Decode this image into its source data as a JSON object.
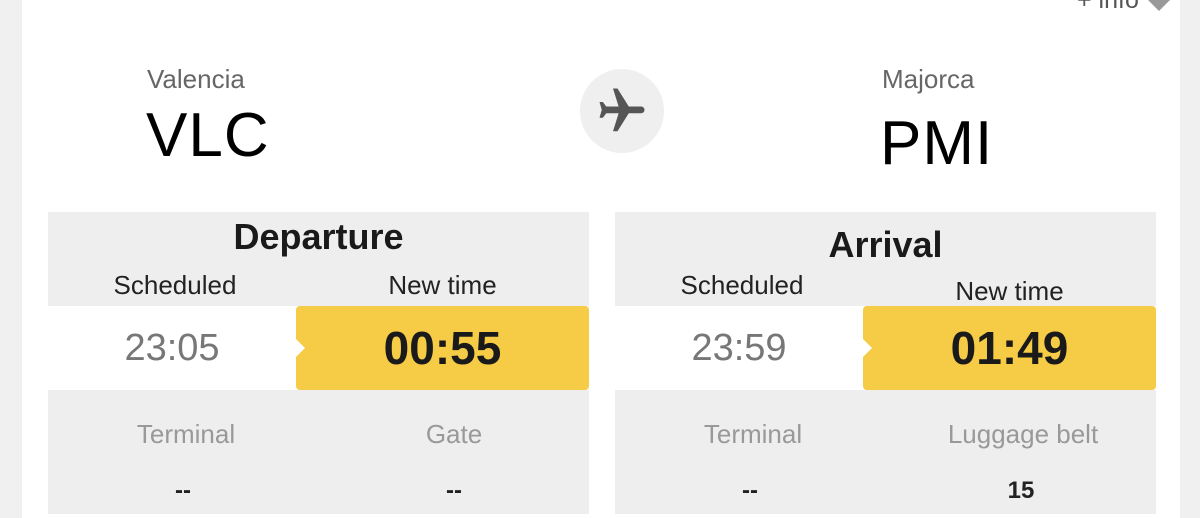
{
  "header": {
    "more_info": "+ info"
  },
  "route": {
    "origin": {
      "city": "Valencia",
      "code": "VLC"
    },
    "destination": {
      "city": "Majorca",
      "code": "PMI"
    },
    "icon": "plane-icon"
  },
  "departure": {
    "title": "Departure",
    "scheduled_label": "Scheduled",
    "new_time_label": "New time",
    "scheduled": "23:05",
    "new_time": "00:55",
    "terminal_label": "Terminal",
    "terminal": "--",
    "gate_label": "Gate",
    "gate": "--"
  },
  "arrival": {
    "title": "Arrival",
    "scheduled_label": "Scheduled",
    "new_time_label": "New time",
    "scheduled": "23:59",
    "new_time": "01:49",
    "terminal_label": "Terminal",
    "terminal": "--",
    "belt_label": "Luggage belt",
    "belt": "15"
  },
  "colors": {
    "highlight": "#f6cb45",
    "panel": "#eeeeee"
  }
}
